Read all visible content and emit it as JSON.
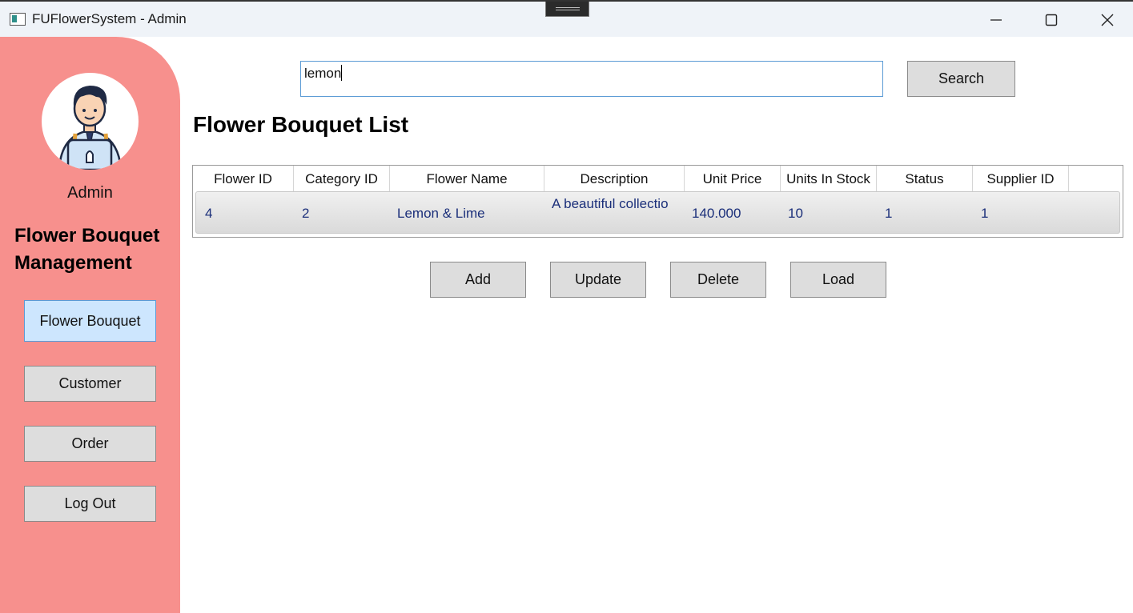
{
  "window": {
    "title": "FUFlowerSystem - Admin",
    "controls": {
      "minimize": "minimize-icon",
      "maximize": "maximize-icon",
      "close": "close-icon"
    }
  },
  "sidebar": {
    "user_label": "Admin",
    "section_title": "Flower Bouquet Management",
    "items": [
      {
        "label": "Flower Bouquet",
        "active": true
      },
      {
        "label": "Customer",
        "active": false
      },
      {
        "label": "Order",
        "active": false
      },
      {
        "label": "Log Out",
        "active": false
      }
    ],
    "background_color": "#f7908d",
    "active_color": "#cde6fe"
  },
  "search": {
    "value": "lemon",
    "button_label": "Search"
  },
  "main": {
    "title": "Flower Bouquet List",
    "table": {
      "columns": [
        "Flower ID",
        "Category ID",
        "Flower Name",
        "Description",
        "Unit Price",
        "Units In Stock",
        "Status",
        "Supplier ID"
      ],
      "rows": [
        [
          "4",
          "2",
          "Lemon & Lime",
          "A beautiful collectio",
          "140.000",
          "10",
          "1",
          "1"
        ]
      ]
    },
    "actions": [
      "Add",
      "Update",
      "Delete",
      "Load"
    ]
  }
}
